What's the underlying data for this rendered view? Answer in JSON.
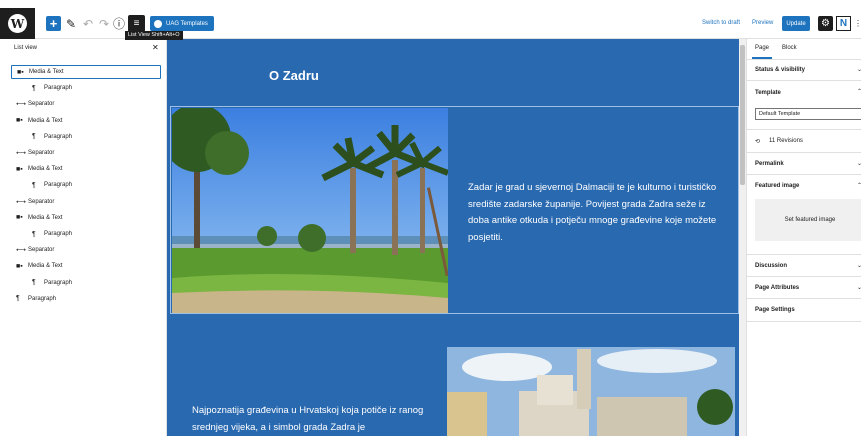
{
  "toolbar": {
    "uag_label": "UAG Templates",
    "tooltip": "List View  Shift+Alt+O",
    "switch_to_draft": "Switch to draft",
    "preview": "Preview",
    "update": "Update"
  },
  "listview": {
    "title": "List view",
    "items": [
      {
        "label": "Media & Text",
        "icon": "media-text-icon",
        "level": 0
      },
      {
        "label": "Paragraph",
        "icon": "paragraph-icon",
        "level": 1
      },
      {
        "label": "Separator",
        "icon": "separator-icon",
        "level": 0
      },
      {
        "label": "Media & Text",
        "icon": "media-text-icon",
        "level": 0
      },
      {
        "label": "Paragraph",
        "icon": "paragraph-icon",
        "level": 1
      },
      {
        "label": "Separator",
        "icon": "separator-icon",
        "level": 0
      },
      {
        "label": "Media & Text",
        "icon": "media-text-icon",
        "level": 0
      },
      {
        "label": "Paragraph",
        "icon": "paragraph-icon",
        "level": 1
      },
      {
        "label": "Separator",
        "icon": "separator-icon",
        "level": 0
      },
      {
        "label": "Media & Text",
        "icon": "media-text-icon",
        "level": 0
      },
      {
        "label": "Paragraph",
        "icon": "paragraph-icon",
        "level": 1
      },
      {
        "label": "Separator",
        "icon": "separator-icon",
        "level": 0
      },
      {
        "label": "Media & Text",
        "icon": "media-text-icon",
        "level": 0
      },
      {
        "label": "Paragraph",
        "icon": "paragraph-icon",
        "level": 1
      },
      {
        "label": "Paragraph",
        "icon": "paragraph-icon",
        "level": 0
      }
    ]
  },
  "canvas": {
    "title": "O Zadru",
    "block1_text": "Zadar je grad u sjevernoj Dalmaciji te je kulturno i turističko središte zadarske županije. Povijest grada Zadra seže iz doba antike otkuda i potječu mnoge građevine koje možete posjetiti.",
    "block2_text": "Najpoznatija građevina u Hrvatskoj koja potiče iz ranog srednjeg vijeka, a i simbol grada Zadra je"
  },
  "sidebar": {
    "tab_page": "Page",
    "tab_block": "Block",
    "status_visibility": "Status & visibility",
    "template": "Template",
    "template_value": "Default Template",
    "revisions": "11 Revisions",
    "permalink": "Permalink",
    "featured_image": "Featured image",
    "set_featured": "Set featured image",
    "discussion": "Discussion",
    "page_attributes": "Page Attributes",
    "page_settings": "Page Settings"
  },
  "colors": {
    "accent": "#1e73be",
    "canvas_bg": "#2969b0",
    "dark": "#1e1e1e"
  }
}
